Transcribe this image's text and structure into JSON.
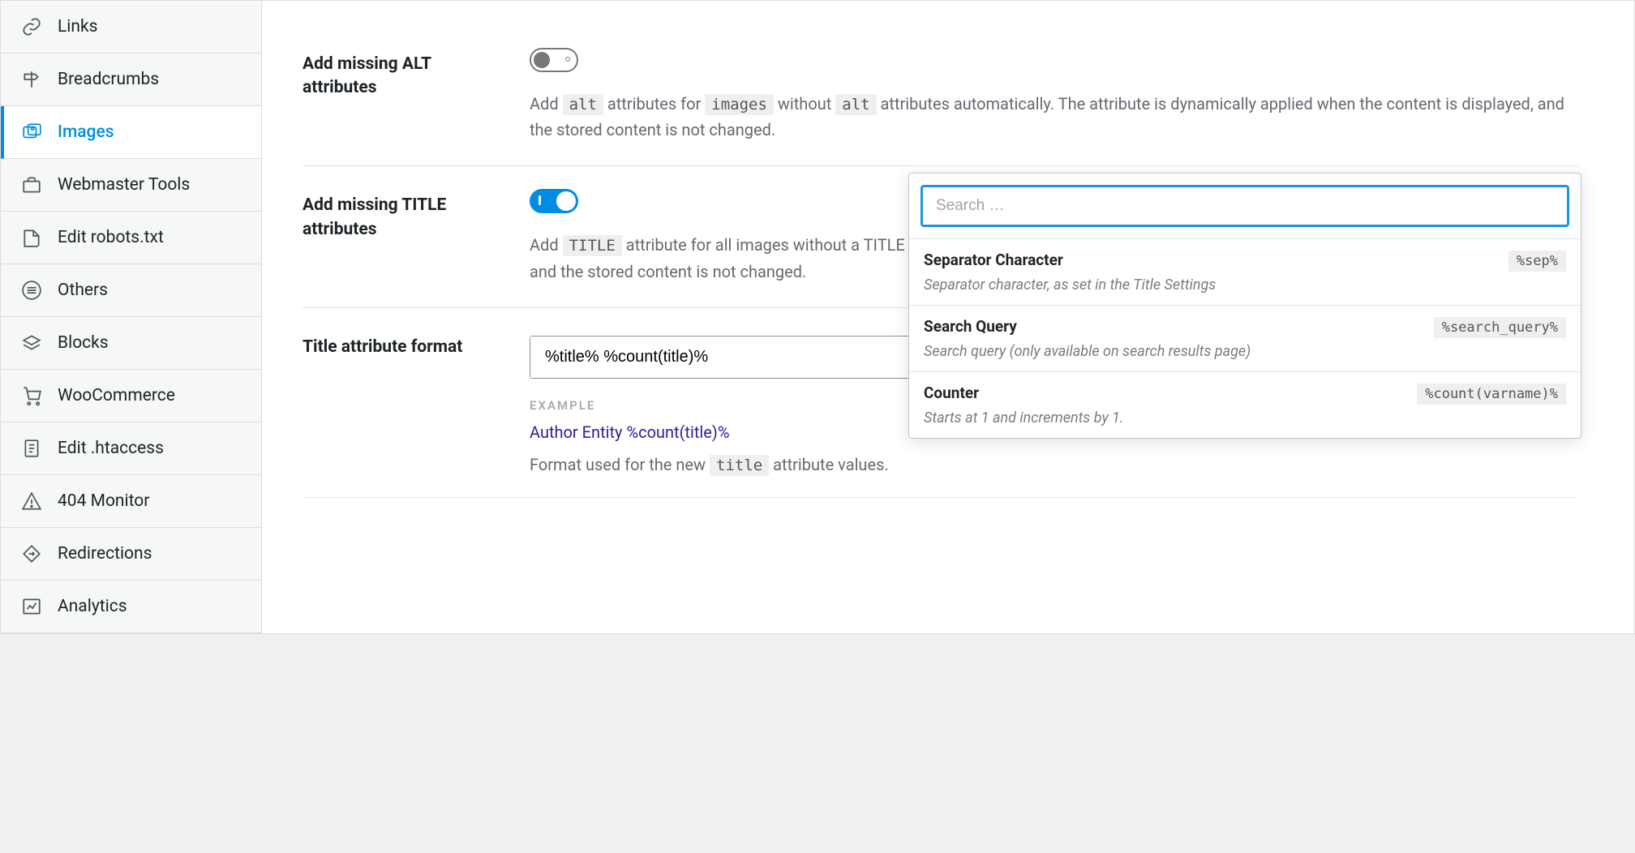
{
  "sidebar": {
    "items": [
      {
        "label": "Links"
      },
      {
        "label": "Breadcrumbs"
      },
      {
        "label": "Images"
      },
      {
        "label": "Webmaster Tools"
      },
      {
        "label": "Edit robots.txt"
      },
      {
        "label": "Others"
      },
      {
        "label": "Blocks"
      },
      {
        "label": "WooCommerce"
      },
      {
        "label": "Edit .htaccess"
      },
      {
        "label": "404 Monitor"
      },
      {
        "label": "Redirections"
      },
      {
        "label": "Analytics"
      }
    ]
  },
  "settings": {
    "alt": {
      "label": "Add missing ALT attributes",
      "desc_prefix": "Add ",
      "desc_code1": "alt",
      "desc_mid1": " attributes for ",
      "desc_code2": "images",
      "desc_mid2": " without ",
      "desc_code3": "alt",
      "desc_suffix": " attributes automatically. The attribute is dynamically applied when the content is displayed, and the stored content is not changed."
    },
    "title": {
      "label": "Add missing TITLE attributes",
      "desc_prefix": "Add ",
      "desc_code1": "TITLE",
      "desc_suffix": " attribute for all images without a TITLE attribute automatically. The attribute is dynamically applied when the content is displayed, and the stored content is not changed."
    },
    "format": {
      "label": "Title attribute format",
      "value": "%title% %count(title)%",
      "example_label": "EXAMPLE",
      "example_value": "Author Entity %count(title)%",
      "example_desc_prefix": "Format used for the new ",
      "example_desc_code": "title",
      "example_desc_suffix": " attribute values."
    }
  },
  "popup": {
    "search_placeholder": "Search …",
    "items": [
      {
        "title": "Separator Character",
        "code": "%sep%",
        "desc": "Separator character, as set in the Title Settings"
      },
      {
        "title": "Search Query",
        "code": "%search_query%",
        "desc": "Search query (only available on search results page)"
      },
      {
        "title": "Counter",
        "code": "%count(varname)%",
        "desc": "Starts at 1 and increments by 1."
      }
    ]
  }
}
